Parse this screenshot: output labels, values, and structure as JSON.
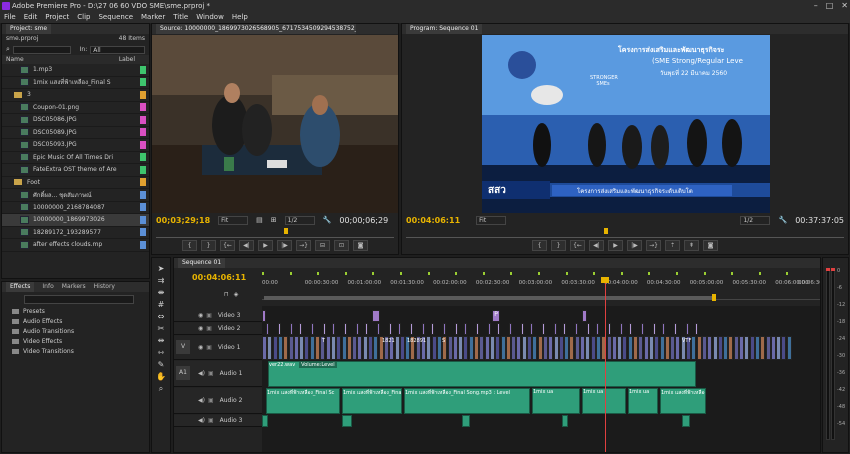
{
  "titlebar": {
    "title": "Adobe Premiere Pro - D:\\27 06 60 VDO SME\\sme.prproj *"
  },
  "menu": [
    "File",
    "Edit",
    "Project",
    "Clip",
    "Sequence",
    "Marker",
    "Title",
    "Window",
    "Help"
  ],
  "project": {
    "tab": "Project: sme",
    "file": "sme.prproj",
    "count": "48 Items",
    "in_label": "In:",
    "in_value": "All",
    "col_name": "Name",
    "col_label": "Label",
    "items": [
      {
        "name": "1.mp3",
        "kind": "file",
        "color": "#3ec46d"
      },
      {
        "name": "1mix แสงที่ฟ้าเหลือง_Final S",
        "kind": "file",
        "color": "#3ec46d"
      },
      {
        "name": "3",
        "kind": "folder",
        "color": "#e0a030"
      },
      {
        "name": "Coupon-01.png",
        "kind": "file",
        "color": "#d94fc2"
      },
      {
        "name": "DSC05086.JPG",
        "kind": "file",
        "color": "#d94fc2"
      },
      {
        "name": "DSC05089.JPG",
        "kind": "file",
        "color": "#d94fc2"
      },
      {
        "name": "DSC05093.JPG",
        "kind": "file",
        "color": "#d94fc2"
      },
      {
        "name": "Epic Music Of All Times Dri",
        "kind": "file",
        "color": "#3ec46d"
      },
      {
        "name": "FateExtra OST theme of Are",
        "kind": "file",
        "color": "#3ec46d"
      },
      {
        "name": "Foot",
        "kind": "folder",
        "color": "#e0a030"
      },
      {
        "name": "ศักดิ์ผล... ชุดสัมภาษณ์",
        "kind": "file",
        "color": "#5b8fd6"
      },
      {
        "name": "10000000_2168784087",
        "kind": "file",
        "color": "#5b8fd6"
      },
      {
        "name": "10000000_1869973026",
        "kind": "file",
        "color": "#5b8fd6"
      },
      {
        "name": "18289172_193289577",
        "kind": "file",
        "color": "#5b8fd6"
      },
      {
        "name": "after effects clouds.mp",
        "kind": "file",
        "color": "#5b8fd6"
      }
    ]
  },
  "effects": {
    "tabs": [
      "Effects",
      "Info",
      "Markers",
      "History"
    ],
    "items": [
      "Presets",
      "Audio Effects",
      "Audio Transitions",
      "Video Effects",
      "Video Transitions"
    ]
  },
  "source": {
    "tab": "Source: 10000000_1869973026568905_6717534509294538752_n.mp4",
    "timecode": "00;03;29;18",
    "fit": "Fit",
    "scale": "1/2",
    "duration": "00;00;06;29"
  },
  "program": {
    "tab": "Program: Sequence 01",
    "timecode": "00:04:06:11",
    "fit": "Fit",
    "scale": "1/2",
    "duration": "00:37:37:05",
    "banner_line1": "โครงการส่งเสริมและพัฒนาธุรกิจระ",
    "banner_line2": "(SME Strong/Regular Leve",
    "banner_line3": "วันพุธที่ 22 มีนาคม 2560",
    "logo_text": "STRONGER SMEs",
    "lower_logo": "สสว",
    "lower_text": "โครงการส่งเสริมและพัฒนาธุรกิจระดับเติบโต"
  },
  "timeline": {
    "tab": "Sequence 01",
    "timecode": "00:04:06:11",
    "ruler": [
      "00:00",
      "00:00:30:00",
      "00:01:00:00",
      "00:01:30:00",
      "00:02:00:00",
      "00:02:30:00",
      "00:03:00:00",
      "00:03:30:00",
      "00:04:00:00",
      "00:04:30:00",
      "00:05:00:00",
      "00:05:30:00",
      "00:06:00:00",
      "00:06:30"
    ],
    "tracks": [
      "Video 3",
      "Video 2",
      "Video 1",
      "Audio 1",
      "Audio 2",
      "Audio 3"
    ],
    "v_label": "V",
    "a_label": "A1",
    "audio1_clip": "ver22.wav",
    "audio1_vol": "Volume:Level",
    "audio2_clips": [
      "1mix แสงที่ฟ้าเหลือง_Final Sc",
      "1mix แสงที่ฟ้าเหลือง_Final Sc",
      "1mix แสงที่ฟ้าเหลือง_Final Song.mp3 : Level",
      "1mix ua",
      "1mix ua",
      "1mix ua",
      "1mix แสงที่ฟ้าเหลือง_Fi"
    ],
    "marker_p": "P",
    "v1_labels": [
      "T",
      "1821",
      "182891",
      "S",
      "VTF"
    ]
  },
  "meter": [
    "0",
    "-6",
    "-12",
    "-18",
    "-24",
    "-30",
    "-36",
    "-42",
    "-48",
    "-54"
  ]
}
